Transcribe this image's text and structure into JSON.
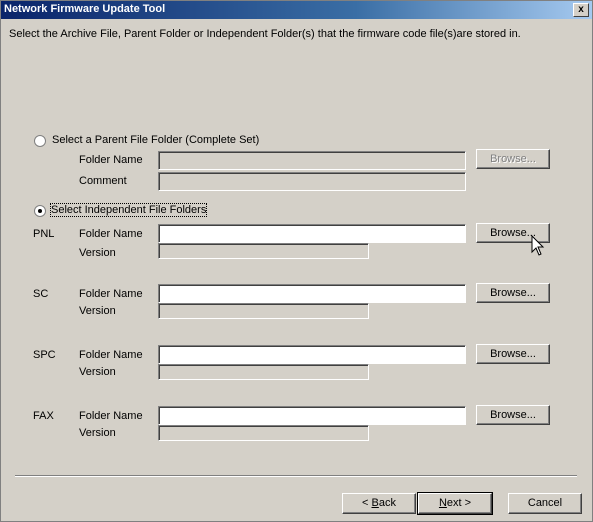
{
  "window": {
    "title": "Network Firmware Update Tool",
    "close_label": "x"
  },
  "instruction": "Select the Archive File, Parent Folder or Independent Folder(s) that the firmware code file(s)are stored in.",
  "parent_option": {
    "label": "Select a Parent File Folder (Complete Set)",
    "selected": false,
    "folder_label": "Folder Name",
    "folder_value": "",
    "comment_label": "Comment",
    "comment_value": "",
    "browse_label": "Browse..."
  },
  "independent_option": {
    "label": "Select Independent File Folders",
    "selected": true,
    "groups": [
      {
        "tag": "PNL",
        "folder_label": "Folder Name",
        "folder_value": "",
        "version_label": "Version",
        "version_value": "",
        "browse_label": "Browse..."
      },
      {
        "tag": "SC",
        "folder_label": "Folder Name",
        "folder_value": "",
        "version_label": "Version",
        "version_value": "",
        "browse_label": "Browse..."
      },
      {
        "tag": "SPC",
        "folder_label": "Folder Name",
        "folder_value": "",
        "version_label": "Version",
        "version_value": "",
        "browse_label": "Browse..."
      },
      {
        "tag": "FAX",
        "folder_label": "Folder Name",
        "folder_value": "",
        "version_label": "Version",
        "version_value": "",
        "browse_label": "Browse..."
      }
    ]
  },
  "footer": {
    "back_prefix": "< ",
    "back_accel": "B",
    "back_rest": "ack",
    "next_accel": "N",
    "next_rest": "ext >",
    "cancel_label": "Cancel"
  }
}
